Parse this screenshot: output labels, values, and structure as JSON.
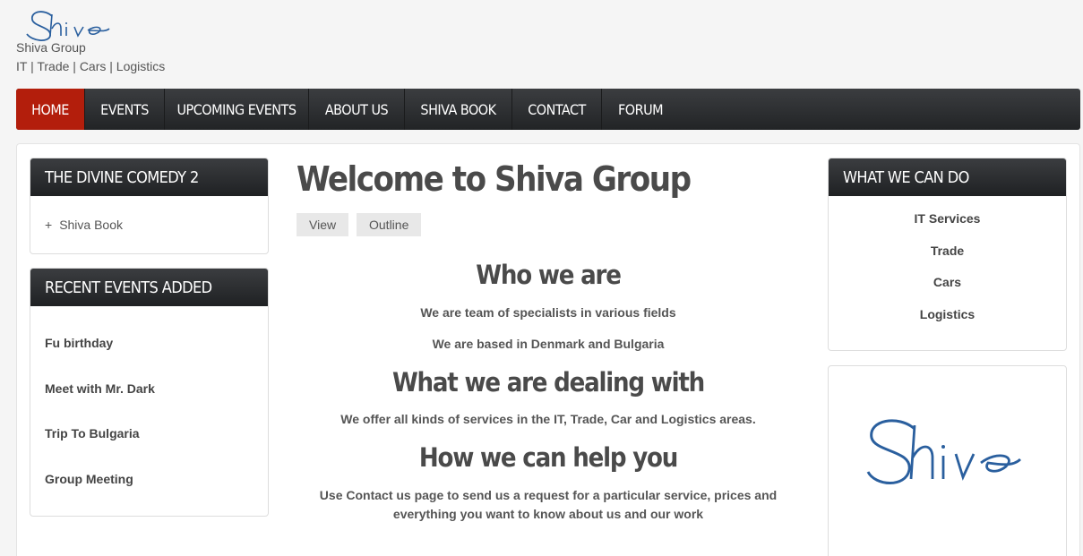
{
  "header": {
    "site_name": "Shiva Group",
    "slogan": "IT | Trade | Cars | Logistics",
    "brand_color": "#2a5f9e"
  },
  "nav": {
    "items": [
      "HOME",
      "EVENTS",
      "UPCOMING EVENTS",
      "ABOUT US",
      "SHIVA BOOK",
      "CONTACT",
      "FORUM"
    ],
    "active": "HOME",
    "active_color": "#b31e0c"
  },
  "left": {
    "book_block": {
      "title": "THE DIVINE COMEDY 2",
      "link_prefix": "+",
      "link": "Shiva Book"
    },
    "events_block": {
      "title": "RECENT EVENTS ADDED",
      "items": [
        "Fu birthday",
        "Meet with Mr. Dark",
        "Trip To Bulgaria",
        "Group Meeting"
      ]
    }
  },
  "content": {
    "title": "Welcome to Shiva Group",
    "tabs": [
      "View",
      "Outline"
    ],
    "sections": [
      {
        "heading": "Who we are",
        "paragraphs": [
          "We are team of specialists in various fields",
          "We are based in Denmark and Bulgaria"
        ]
      },
      {
        "heading": "What we are dealing with",
        "paragraphs": [
          "We offer all kinds of services in the IT, Trade, Car and Logistics areas."
        ]
      },
      {
        "heading": "How we can help you",
        "paragraphs": [
          "Use Contact us page to send us a request for a particular service, prices and",
          "everything you want to know about us and our work"
        ]
      }
    ]
  },
  "right": {
    "what_block": {
      "title": "WHAT WE CAN DO",
      "items": [
        "IT Services",
        "Trade",
        "Cars",
        "Logistics"
      ]
    },
    "logo_block": {
      "logo_icon": "shiva-script-logo"
    }
  }
}
